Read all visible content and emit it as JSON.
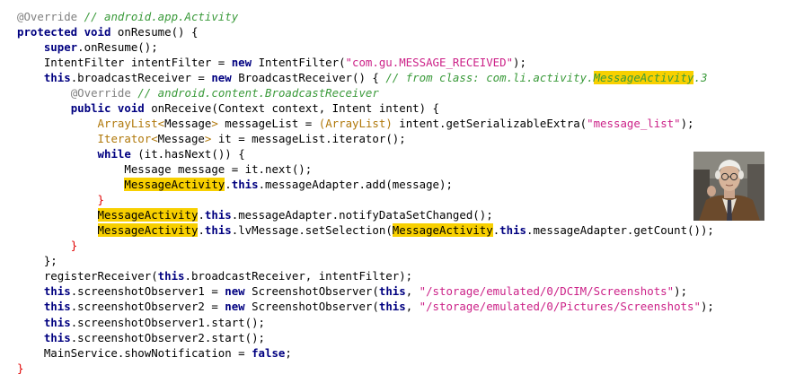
{
  "editor": {
    "lines": [
      [
        {
          "t": "@Override ",
          "c": "ann"
        },
        {
          "t": "// android.app.Activity",
          "c": "cmt"
        }
      ],
      [
        {
          "t": "protected void ",
          "c": "kw"
        },
        {
          "t": "onResume() {",
          "c": "plain"
        }
      ],
      [
        {
          "t": "    ",
          "c": "plain"
        },
        {
          "t": "super",
          "c": "kw"
        },
        {
          "t": ".onResume();",
          "c": "plain"
        }
      ],
      [
        {
          "t": "    IntentFilter intentFilter = ",
          "c": "plain"
        },
        {
          "t": "new ",
          "c": "kw"
        },
        {
          "t": "IntentFilter(",
          "c": "plain"
        },
        {
          "t": "\"com.gu.MESSAGE_RECEIVED\"",
          "c": "str"
        },
        {
          "t": ");",
          "c": "plain"
        }
      ],
      [
        {
          "t": "    ",
          "c": "plain"
        },
        {
          "t": "this",
          "c": "kw"
        },
        {
          "t": ".broadcastReceiver = ",
          "c": "plain"
        },
        {
          "t": "new ",
          "c": "kw"
        },
        {
          "t": "BroadcastReceiver() { ",
          "c": "plain"
        },
        {
          "t": "// from class: com.li.activity.",
          "c": "cmt"
        },
        {
          "t": "MessageActivity",
          "c": "hl-italic"
        },
        {
          "t": ".3",
          "c": "cmt"
        }
      ],
      [
        {
          "t": "        ",
          "c": "plain"
        },
        {
          "t": "@Override ",
          "c": "ann"
        },
        {
          "t": "// android.content.BroadcastReceiver",
          "c": "cmt"
        }
      ],
      [
        {
          "t": "        ",
          "c": "plain"
        },
        {
          "t": "public void ",
          "c": "kw"
        },
        {
          "t": "onReceive(Context context, Intent intent) {",
          "c": "plain"
        }
      ],
      [
        {
          "t": "            ",
          "c": "plain"
        },
        {
          "t": "ArrayList<",
          "c": "gen"
        },
        {
          "t": "Message",
          "c": "plain"
        },
        {
          "t": ">",
          "c": "gen"
        },
        {
          "t": " messageList = ",
          "c": "plain"
        },
        {
          "t": "(ArrayList)",
          "c": "gen"
        },
        {
          "t": " intent.getSerializableExtra(",
          "c": "plain"
        },
        {
          "t": "\"message_list\"",
          "c": "str"
        },
        {
          "t": ");",
          "c": "plain"
        }
      ],
      [
        {
          "t": "            ",
          "c": "plain"
        },
        {
          "t": "Iterator<",
          "c": "gen"
        },
        {
          "t": "Message",
          "c": "plain"
        },
        {
          "t": ">",
          "c": "gen"
        },
        {
          "t": " it = messageList.iterator();",
          "c": "plain"
        }
      ],
      [
        {
          "t": "            ",
          "c": "plain"
        },
        {
          "t": "while ",
          "c": "kw"
        },
        {
          "t": "(it.hasNext()) {",
          "c": "plain"
        }
      ],
      [
        {
          "t": "                Message message = it.next();",
          "c": "plain"
        }
      ],
      [
        {
          "t": "                ",
          "c": "plain"
        },
        {
          "t": "MessageActivity",
          "c": "hl"
        },
        {
          "t": ".",
          "c": "plain"
        },
        {
          "t": "this",
          "c": "kw"
        },
        {
          "t": ".messageAdapter.add(message);",
          "c": "plain"
        }
      ],
      [
        {
          "t": "            ",
          "c": "plain"
        },
        {
          "t": "}",
          "c": "closebrace"
        }
      ],
      [
        {
          "t": "            ",
          "c": "plain"
        },
        {
          "t": "MessageActivity",
          "c": "hl"
        },
        {
          "t": ".",
          "c": "plain"
        },
        {
          "t": "this",
          "c": "kw"
        },
        {
          "t": ".messageAdapter.notifyDataSetChanged();",
          "c": "plain"
        }
      ],
      [
        {
          "t": "            ",
          "c": "plain"
        },
        {
          "t": "MessageActivity",
          "c": "hl"
        },
        {
          "t": ".",
          "c": "plain"
        },
        {
          "t": "this",
          "c": "kw"
        },
        {
          "t": ".lvMessage.setSelection(",
          "c": "plain"
        },
        {
          "t": "MessageActivity",
          "c": "hl"
        },
        {
          "t": ".",
          "c": "plain"
        },
        {
          "t": "this",
          "c": "kw"
        },
        {
          "t": ".messageAdapter.getCount());",
          "c": "plain"
        }
      ],
      [
        {
          "t": "        ",
          "c": "plain"
        },
        {
          "t": "}",
          "c": "closebrace"
        }
      ],
      [
        {
          "t": "    };",
          "c": "plain"
        }
      ],
      [
        {
          "t": "    registerReceiver(",
          "c": "plain"
        },
        {
          "t": "this",
          "c": "kw"
        },
        {
          "t": ".broadcastReceiver, intentFilter);",
          "c": "plain"
        }
      ],
      [
        {
          "t": "    ",
          "c": "plain"
        },
        {
          "t": "this",
          "c": "kw"
        },
        {
          "t": ".screenshotObserver1 = ",
          "c": "plain"
        },
        {
          "t": "new ",
          "c": "kw"
        },
        {
          "t": "ScreenshotObserver(",
          "c": "plain"
        },
        {
          "t": "this",
          "c": "kw"
        },
        {
          "t": ", ",
          "c": "plain"
        },
        {
          "t": "\"/storage/emulated/0/DCIM/Screenshots\"",
          "c": "str"
        },
        {
          "t": ");",
          "c": "plain"
        }
      ],
      [
        {
          "t": "    ",
          "c": "plain"
        },
        {
          "t": "this",
          "c": "kw"
        },
        {
          "t": ".screenshotObserver2 = ",
          "c": "plain"
        },
        {
          "t": "new ",
          "c": "kw"
        },
        {
          "t": "ScreenshotObserver(",
          "c": "plain"
        },
        {
          "t": "this",
          "c": "kw"
        },
        {
          "t": ", ",
          "c": "plain"
        },
        {
          "t": "\"/storage/emulated/0/Pictures/Screenshots\"",
          "c": "str"
        },
        {
          "t": ");",
          "c": "plain"
        }
      ],
      [
        {
          "t": "    ",
          "c": "plain"
        },
        {
          "t": "this",
          "c": "kw"
        },
        {
          "t": ".screenshotObserver1.start();",
          "c": "plain"
        }
      ],
      [
        {
          "t": "    ",
          "c": "plain"
        },
        {
          "t": "this",
          "c": "kw"
        },
        {
          "t": ".screenshotObserver2.start();",
          "c": "plain"
        }
      ],
      [
        {
          "t": "    MainService.showNotification = ",
          "c": "plain"
        },
        {
          "t": "false",
          "c": "kw"
        },
        {
          "t": ";",
          "c": "plain"
        }
      ],
      [
        {
          "t": "}",
          "c": "closebrace"
        }
      ]
    ]
  },
  "overlay": {
    "image_icon": "portrait-photo"
  },
  "colors": {
    "keyword": "#000080",
    "comment": "#3a9a3a",
    "string": "#cc2288",
    "annotation": "#808080",
    "generic": "#b0780a",
    "highlight": "#f8d000",
    "closing_brace": "#e00000"
  }
}
